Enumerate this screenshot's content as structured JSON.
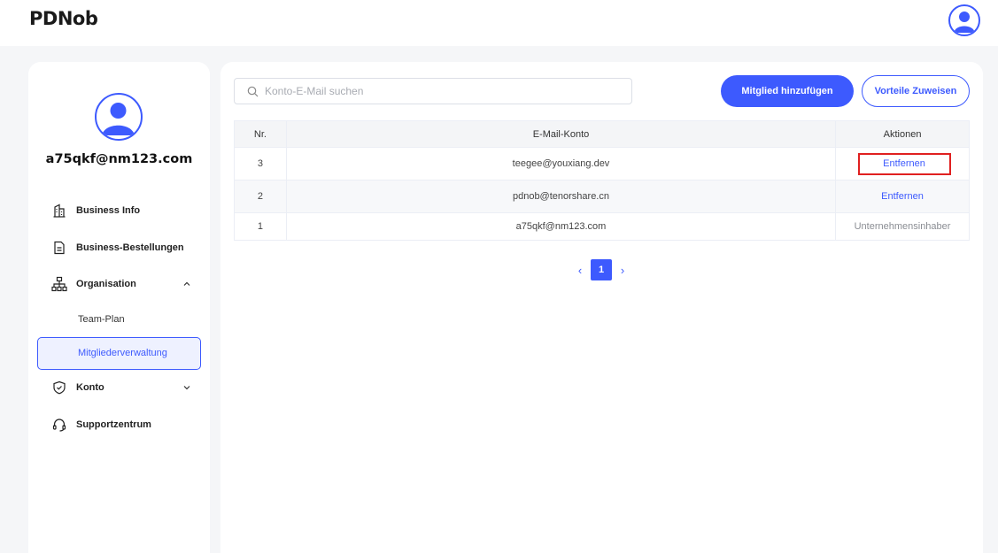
{
  "app": {
    "logo": "PDNob"
  },
  "colors": {
    "accent": "#3d5afe",
    "highlight_border": "#e02020"
  },
  "sidebar": {
    "user_email": "a75qkf@nm123.com",
    "items": [
      {
        "label": "Business Info",
        "icon": "building-icon"
      },
      {
        "label": "Business-Bestellungen",
        "icon": "document-icon"
      },
      {
        "label": "Organisation",
        "icon": "org-chart-icon",
        "expanded": true,
        "children": [
          {
            "label": "Team-Plan"
          },
          {
            "label": "Mitgliederverwaltung",
            "active": true
          }
        ]
      },
      {
        "label": "Konto",
        "icon": "shield-icon",
        "expanded": false
      },
      {
        "label": "Supportzentrum",
        "icon": "headset-icon"
      }
    ]
  },
  "main": {
    "search": {
      "placeholder": "Konto-E-Mail suchen",
      "value": ""
    },
    "add_member_label": "Mitglied hinzufügen",
    "assign_benefits_label": "Vorteile Zuweisen",
    "table": {
      "headers": [
        "Nr.",
        "E-Mail-Konto",
        "Aktionen"
      ],
      "rows": [
        {
          "nr": "3",
          "email": "teegee@youxiang.dev",
          "action": "Entfernen"
        },
        {
          "nr": "2",
          "email": "pdnob@tenorshare.cn",
          "action": "Entfernen"
        },
        {
          "nr": "1",
          "email": "a75qkf@nm123.com",
          "action": "Unternehmensinhaber"
        }
      ]
    },
    "pagination": {
      "current_page": "1",
      "prev": "‹",
      "next": "›"
    }
  }
}
